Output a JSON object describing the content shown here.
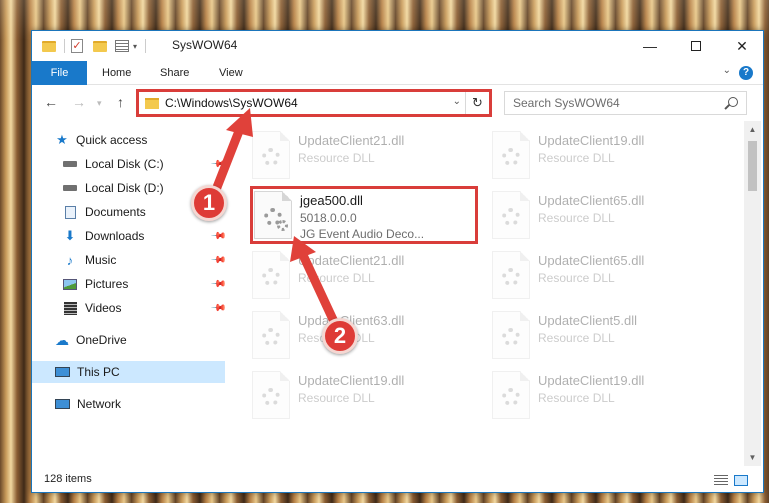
{
  "window": {
    "title": "SysWOW64",
    "minimize_icon": "minimize-icon",
    "maximize_icon": "maximize-icon",
    "close_icon": "close-icon"
  },
  "ribbon": {
    "tabs": [
      "File",
      "Home",
      "Share",
      "View"
    ],
    "help": "?"
  },
  "address": {
    "path": "C:\\Windows\\SysWOW64",
    "search_placeholder": "Search SysWOW64"
  },
  "sidebar": {
    "items": [
      {
        "label": "Quick access",
        "icon": "star-icon"
      },
      {
        "label": "Local Disk (C:)",
        "icon": "drive-icon"
      },
      {
        "label": "Local Disk (D:)",
        "icon": "drive-icon"
      },
      {
        "label": "Documents",
        "icon": "documents-icon"
      },
      {
        "label": "Downloads",
        "icon": "download-icon"
      },
      {
        "label": "Music",
        "icon": "music-icon"
      },
      {
        "label": "Pictures",
        "icon": "pictures-icon"
      },
      {
        "label": "Videos",
        "icon": "videos-icon"
      },
      {
        "label": "OneDrive",
        "icon": "cloud-icon"
      },
      {
        "label": "This PC",
        "icon": "computer-icon"
      },
      {
        "label": "Network",
        "icon": "network-icon"
      }
    ]
  },
  "files": [
    {
      "name": "UpdateClient21.dll",
      "line2": "Resource DLL",
      "line3": ""
    },
    {
      "name": "UpdateClient19.dll",
      "line2": "Resource DLL",
      "line3": ""
    },
    {
      "name": "jgea500.dll",
      "line2": "5018.0.0.0",
      "line3": "JG Event Audio Deco..."
    },
    {
      "name": "UpdateClient65.dll",
      "line2": "Resource DLL",
      "line3": ""
    },
    {
      "name": "UpdateClient21.dll",
      "line2": "Resource DLL",
      "line3": ""
    },
    {
      "name": "UpdateClient65.dll",
      "line2": "Resource DLL",
      "line3": ""
    },
    {
      "name": "UpdateClient63.dll",
      "line2": "Resource DLL",
      "line3": ""
    },
    {
      "name": "UpdateClient5.dll",
      "line2": "Resource DLL",
      "line3": ""
    },
    {
      "name": "UpdateClient19.dll",
      "line2": "Resource DLL",
      "line3": ""
    },
    {
      "name": "UpdateClient19.dll",
      "line2": "Resource DLL",
      "line3": ""
    }
  ],
  "status": {
    "item_count": "128 items"
  },
  "annotations": {
    "badge1": "1",
    "badge2": "2",
    "highlight_color": "#d93d3a"
  }
}
